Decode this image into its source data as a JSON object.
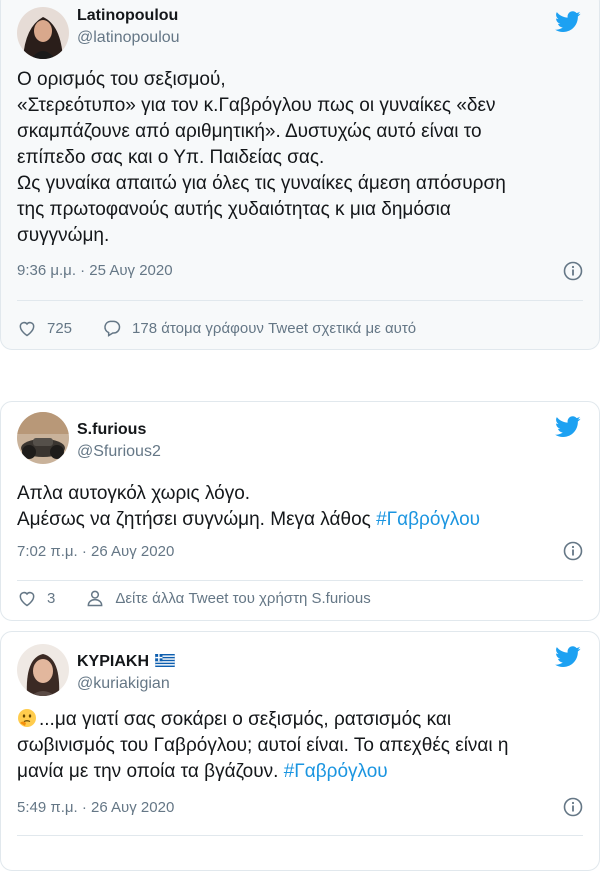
{
  "tweets": [
    {
      "name": "Latinopoulou",
      "handle": "@latinopoulou",
      "lines": [
        "Ο ορισμός του σεξισμού,",
        "«Στερεότυπο» για τον κ.Γαβρόγλου πως οι γυναίκες «δεν",
        "σκαμπάζουνε από αριθμητική». Δυστυχώς αυτό είναι το",
        "επίπεδο σας και ο Υπ. Παιδείας σας.",
        "Ως γυναίκα απαιτώ για όλες τις γυναίκες άμεση απόσυρση",
        "της πρωτοφανούς αυτής χυδαιότητας κ μια δημόσια",
        "συγγνώμη."
      ],
      "timestamp": "9:36 μ.μ. · 25 Αυγ 2020",
      "likes": "725",
      "replies_text": "178 άτομα γράφουν Tweet σχετικά με αυτό"
    },
    {
      "name": "S.furious",
      "handle": "@Sfurious2",
      "line1": "Απλα αυτογκόλ χωρις λόγο.",
      "line2": "Αμέσως να ζητήσει συγνώμη. Μεγα λάθος ",
      "hashtag": "#Γαβρόγλου",
      "timestamp": "7:02 π.μ. · 26 Αυγ 2020",
      "likes": "3",
      "more_text": "Δείτε άλλα Tweet του χρήστη S.furious"
    },
    {
      "name": "ΚΥΡΙΑΚΗ",
      "handle": "@kuriakigian",
      "line1": "...μα γιατί σας σοκάρει ο σεξισμός, ρατσισμός και",
      "line2": "σωβινισμός του Γαβρόγλου; αυτοί είναι. Το απεχθές είναι η",
      "line3": "μανία με την οποία τα βγάζουν. ",
      "hashtag": "#Γαβρόγλου",
      "timestamp": "5:49 π.μ. · 26 Αυγ 2020"
    }
  ],
  "colors": {
    "twitter_blue": "#1da1f2",
    "link": "#1b95e0",
    "secondary_text": "#657786",
    "border": "#e1e8ed"
  },
  "icons": [
    "twitter-bird-icon",
    "info-icon",
    "heart-icon",
    "reply-bubble-icon",
    "person-icon",
    "greek-flag-icon",
    "thinking-face-icon"
  ]
}
